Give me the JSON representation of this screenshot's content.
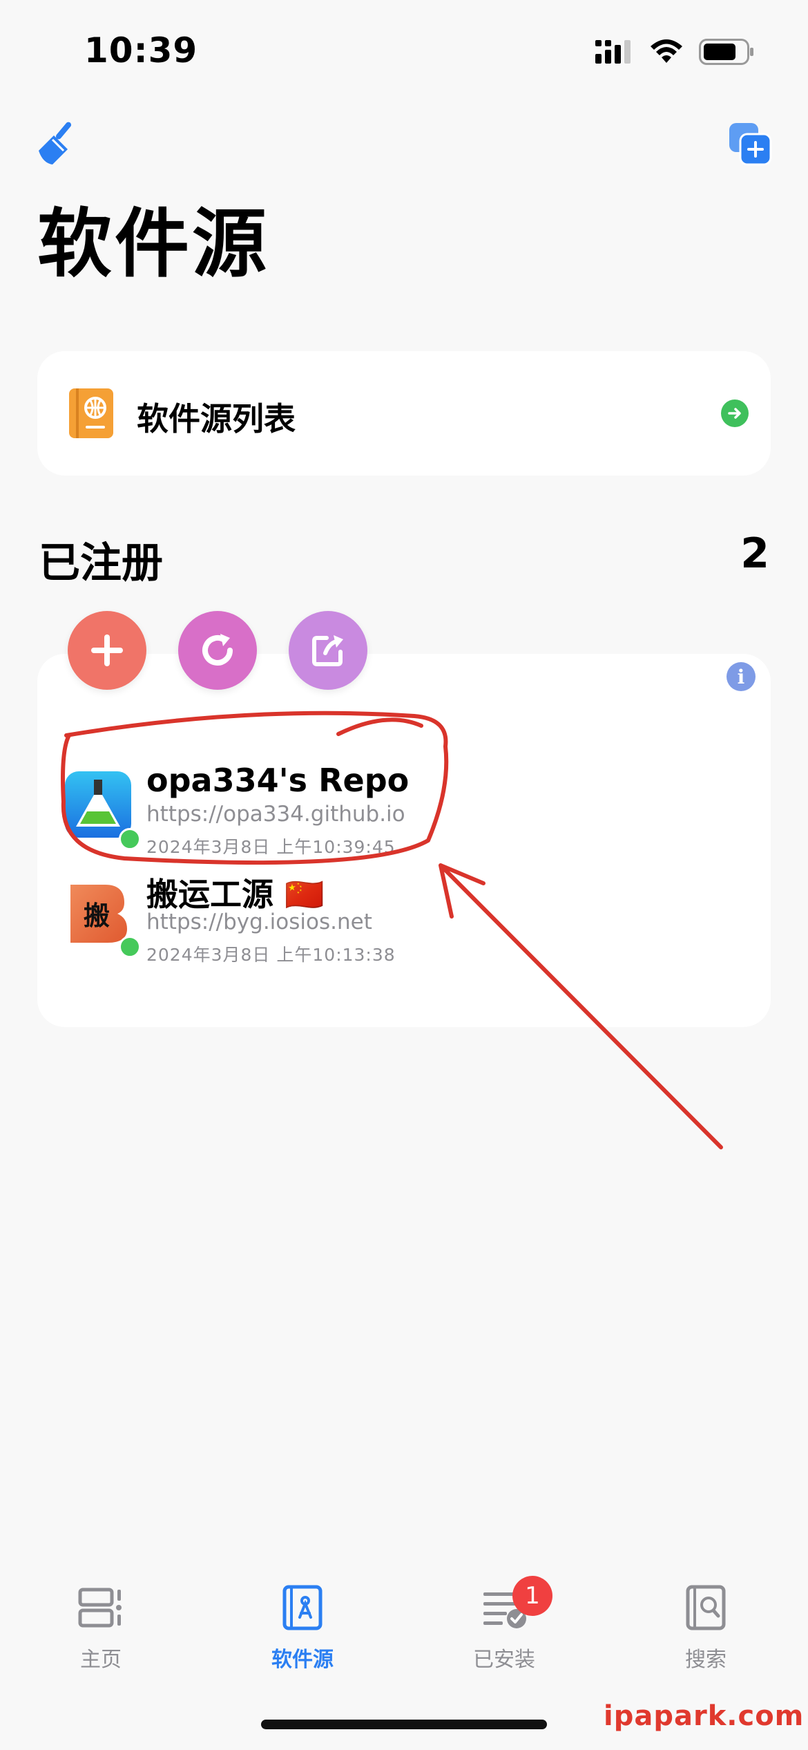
{
  "status_bar": {
    "time": "10:39"
  },
  "header": {
    "title": "软件源"
  },
  "source_list_card": {
    "label": "软件源列表"
  },
  "registered": {
    "title": "已注册",
    "count": "2",
    "info_glyph": "i",
    "repos": [
      {
        "name": "opa334's Repo",
        "url": "https://opa334.github.io",
        "date": "2024年3月8日 上午10:39:45",
        "status": "online"
      },
      {
        "name": "搬运工源 🇨🇳",
        "url": "https://byg.iosios.net",
        "date": "2024年3月8日 上午10:13:38",
        "status": "online",
        "icon_text": "搬"
      }
    ]
  },
  "tabs": [
    {
      "label": "主页",
      "icon": "home-icon",
      "active": false
    },
    {
      "label": "软件源",
      "icon": "sources-icon",
      "active": true
    },
    {
      "label": "已安装",
      "icon": "installed-icon",
      "active": false,
      "badge": "1"
    },
    {
      "label": "搜索",
      "icon": "search-icon",
      "active": false
    }
  ],
  "watermark": "ipapark.com",
  "colors": {
    "accent": "#2b7ff2",
    "add": "#f07468",
    "refresh": "#d86fc8",
    "share": "#c98ae0",
    "online": "#45c95a",
    "annotation": "#d9342b"
  }
}
